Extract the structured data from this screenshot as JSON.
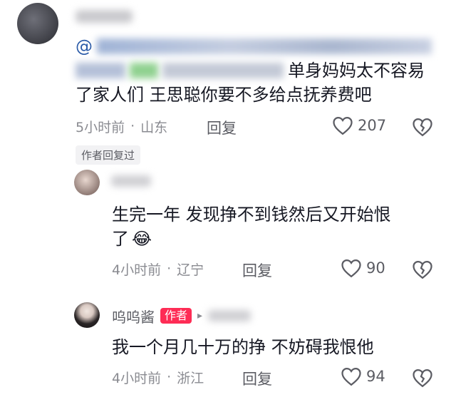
{
  "comments": [
    {
      "username": "",
      "mention_prefix": "@",
      "text_visible_part1": "单身妈妈太不容易",
      "text_visible_part2": "了家人们 王思聪你要不多给点抚养费吧",
      "time": "5小时前",
      "location": "山东",
      "separator": "·",
      "reply_label": "回复",
      "likes": "207",
      "tag": "作者回复过"
    },
    {
      "username": "",
      "text_line1": "生完一年 发现挣不到钱然后又开始恨",
      "text_line2": "了",
      "emoji": "😂",
      "time": "4小时前",
      "location": "辽宁",
      "separator": "·",
      "reply_label": "回复",
      "likes": "90"
    },
    {
      "username": "呜呜酱",
      "author_badge": "作者",
      "reply_arrow": "▸",
      "text": "我一个月几十万的挣 不妨碍我恨他",
      "time": "4小时前",
      "location": "浙江",
      "separator": "·",
      "reply_label": "回复",
      "likes": "94"
    }
  ],
  "icons": {
    "like": "heart-outline-icon",
    "dislike": "broken-heart-icon"
  },
  "colors": {
    "accent": "#fe2c55",
    "mention": "#2b5ba8",
    "meta": "#8a8b91"
  }
}
